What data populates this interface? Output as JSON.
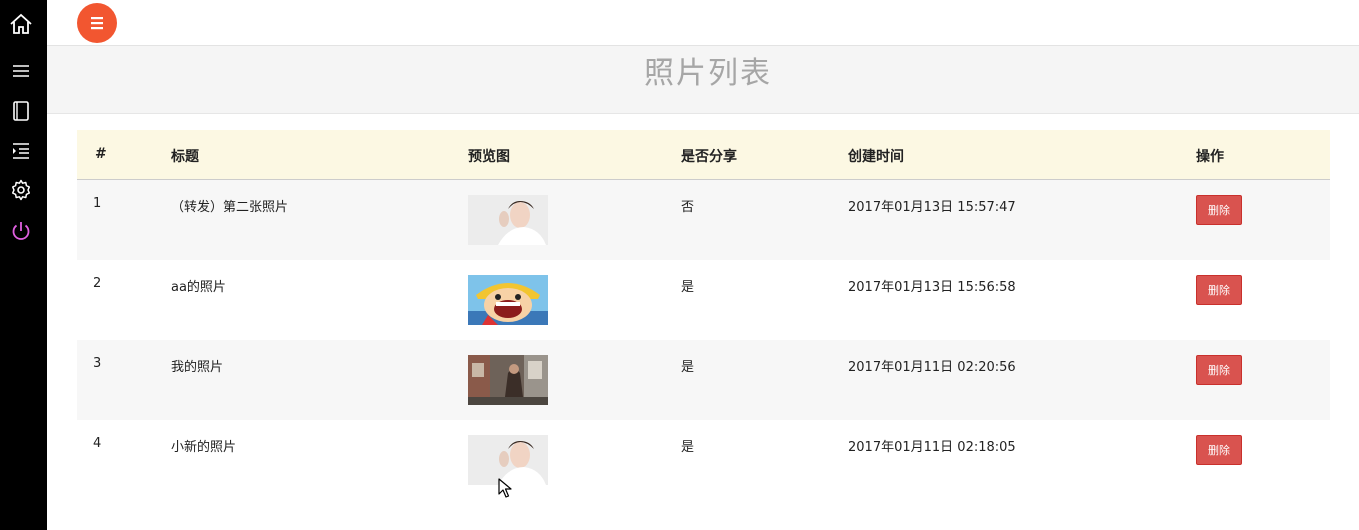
{
  "header": {
    "page_title": "照片列表"
  },
  "sidebar": {
    "items": [
      {
        "icon": "home-icon"
      },
      {
        "icon": "menu-lines-icon"
      },
      {
        "icon": "book-icon"
      },
      {
        "icon": "indent-list-icon"
      },
      {
        "icon": "gear-icon"
      },
      {
        "icon": "power-icon"
      }
    ]
  },
  "table": {
    "columns": [
      "#",
      "标题",
      "预览图",
      "是否分享",
      "创建时间",
      "操作"
    ],
    "rows": [
      {
        "id": "1",
        "title": "（转发）第二张照片",
        "preview": "woman-photo",
        "shared": "否",
        "created": "2017年01月13日 15:57:47",
        "action": "删除"
      },
      {
        "id": "2",
        "title": "aa的照片",
        "preview": "cartoon-photo",
        "shared": "是",
        "created": "2017年01月13日 15:56:58",
        "action": "删除"
      },
      {
        "id": "3",
        "title": "我的照片",
        "preview": "street-photo",
        "shared": "是",
        "created": "2017年01月11日 02:20:56",
        "action": "删除"
      },
      {
        "id": "4",
        "title": "小新的照片",
        "preview": "woman-photo",
        "shared": "是",
        "created": "2017年01月11日 02:18:05",
        "action": "删除"
      }
    ]
  },
  "colors": {
    "sidebar_bg": "#000000",
    "menu_button": "#f25630",
    "table_header_bg": "#fcf8e3",
    "delete_button": "#d9534f"
  }
}
